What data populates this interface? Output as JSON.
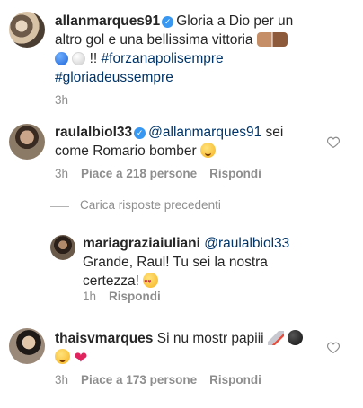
{
  "post": {
    "username": "allanmarques91",
    "caption_line1": "Gloria a Dio per un",
    "caption_line2": "altro gol e una bellissima vittoria",
    "caption_line3_suffix": " !! ",
    "hashtag1": "#forzanapolisempre",
    "hashtag2": "#gloriadeussempre",
    "time": "3h"
  },
  "comments": [
    {
      "username": "raulalbiol33",
      "mention": "@allanmarques91",
      "text_line1_suffix": " sei",
      "text_line2": "come Romario bomber",
      "time": "3h",
      "likes": "Piace a 218 persone",
      "reply": "Rispondi"
    },
    {
      "username": "thaisvmarques",
      "text_line1": "Si nu mostr papiii",
      "time": "3h",
      "likes": "Piace a 173 persone",
      "reply": "Rispondi"
    }
  ],
  "load_previous": "Carica risposte precedenti",
  "reply_comment": {
    "username": "mariagraziaiuliani",
    "mention": "@raulalbiol33",
    "text_line2": "Grande, Raul! Tu sei la nostra",
    "text_line3": "certezza!",
    "time": "1h",
    "reply": "Rispondi"
  },
  "icons": {
    "verified": "verified-badge-icon",
    "like": "heart-icon"
  }
}
